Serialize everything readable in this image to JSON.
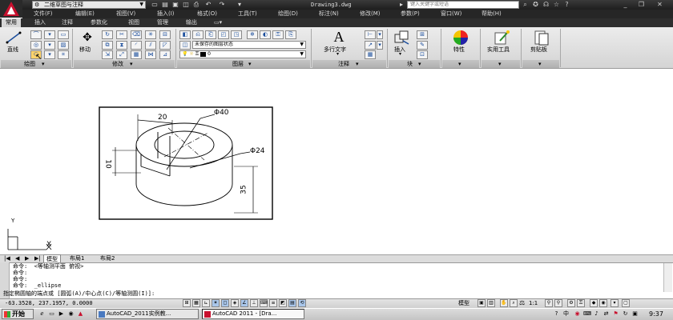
{
  "titlebar": {
    "workspace": "二维草图与注释",
    "document_title": "Drawing3.dwg",
    "search_placeholder": "键入关键字或短语"
  },
  "menu": [
    "文件(F)",
    "编辑(E)",
    "视图(V)",
    "插入(I)",
    "格式(O)",
    "工具(T)",
    "绘图(D)",
    "标注(N)",
    "修改(M)",
    "参数(P)",
    "窗口(W)",
    "帮助(H)"
  ],
  "ribbon_tabs": [
    "常用",
    "插入",
    "注释",
    "参数化",
    "视图",
    "管理",
    "输出"
  ],
  "ribbon": {
    "draw_line_label": "直线",
    "move_label": "移动",
    "layer_state": "未保存的图层状态",
    "layer_current": "0",
    "mtext_label": "多行文字",
    "insert_label": "插入",
    "properties_label": "特性",
    "utilities_label": "实用工具",
    "clipboard_label": "剪贴板",
    "panels": {
      "draw": "绘图",
      "modify": "修改",
      "layers": "图层",
      "annotation": "注释",
      "block": "块"
    }
  },
  "drawing": {
    "dimensions": [
      "20",
      "Φ40",
      "Φ24",
      "10",
      "35"
    ],
    "ucs_x": "X",
    "ucs_y": "Y"
  },
  "layout_tabs": [
    "模型",
    "布局1",
    "布局2"
  ],
  "command_lines": [
    "命令:  <等轴测平面 俯视>",
    "命令:",
    "命令:",
    "命令:  _ellipse",
    "指定椭圆轴的端点或 [圆弧(A)/中心点(C)/等轴测圆(I)]:"
  ],
  "status": {
    "coords": "-63.3528, 237.1957, 0.0000",
    "model_label": "模型",
    "scale_label": "1:1"
  },
  "taskbar": {
    "start_label": "开始",
    "tasks": [
      "AutoCAD_2011实例教...",
      "AutoCAD 2011 - [Dra..."
    ],
    "clock": "9:37"
  },
  "colors": {
    "accent_red": "#c8102e",
    "dark_chrome": "#262626",
    "ribbon_bg": "#e2e2e2"
  }
}
